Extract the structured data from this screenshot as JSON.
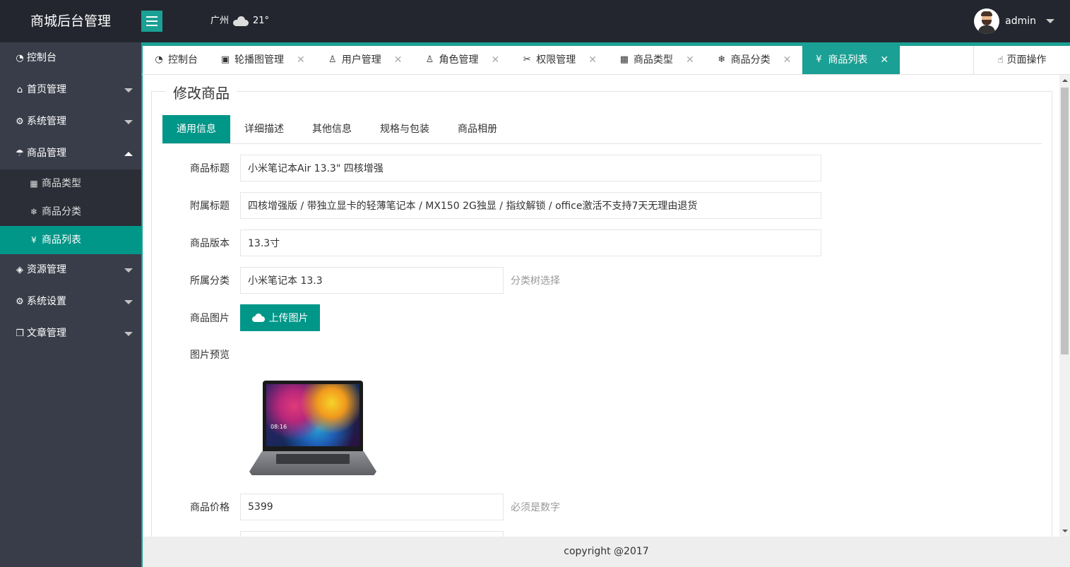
{
  "header": {
    "logo": "商城后台管理",
    "city": "广州",
    "temperature": "21°",
    "username": "admin"
  },
  "sidebar": {
    "items": [
      {
        "label": "控制台",
        "icon": "dashboard-icon"
      },
      {
        "label": "首页管理",
        "icon": "home-icon"
      },
      {
        "label": "系统管理",
        "icon": "gear-icon"
      },
      {
        "label": "商品管理",
        "icon": "umbrella-icon"
      },
      {
        "label": "资源管理",
        "icon": "cube-icon"
      },
      {
        "label": "系统设置",
        "icon": "gear-icon"
      },
      {
        "label": "文章管理",
        "icon": "book-icon"
      }
    ],
    "subitems": [
      {
        "label": "商品类型",
        "icon": "apps-icon"
      },
      {
        "label": "商品分类",
        "icon": "snowflake-icon"
      },
      {
        "label": "商品列表",
        "icon": "yen-icon"
      }
    ]
  },
  "tabs": [
    {
      "label": "控制台"
    },
    {
      "label": "轮播图管理"
    },
    {
      "label": "用户管理"
    },
    {
      "label": "角色管理"
    },
    {
      "label": "权限管理"
    },
    {
      "label": "商品类型"
    },
    {
      "label": "商品分类"
    },
    {
      "label": "商品列表"
    }
  ],
  "page_ops": "页面操作",
  "form": {
    "legend": "修改商品",
    "tabs": [
      "通用信息",
      "详细描述",
      "其他信息",
      "规格与包装",
      "商品相册"
    ],
    "title_label": "商品标题",
    "title_value": "小米笔记本Air 13.3\" 四核增强",
    "subtitle_label": "附属标题",
    "subtitle_value": "四核增强版 / 带独立显卡的轻薄笔记本 / MX150 2G独显 / 指纹解锁 / office激活不支持7天无理由退货",
    "version_label": "商品版本",
    "version_value": "13.3寸",
    "category_label": "所属分类",
    "category_value": "小米笔记本 13.3",
    "category_hint": "分类树选择",
    "image_label": "商品图片",
    "upload_label": "上传图片",
    "preview_label": "图片预览",
    "price_label": "商品价格",
    "price_value": "5399",
    "price_hint": "必须是数字"
  },
  "footer": "copyright @2017"
}
